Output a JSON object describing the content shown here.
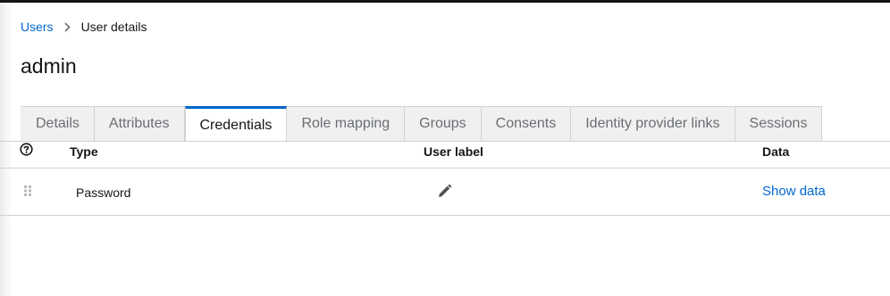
{
  "breadcrumb": {
    "parent": "Users",
    "current": "User details"
  },
  "page_title": "admin",
  "tabs": [
    {
      "label": "Details"
    },
    {
      "label": "Attributes"
    },
    {
      "label": "Credentials",
      "active": true
    },
    {
      "label": "Role mapping"
    },
    {
      "label": "Groups"
    },
    {
      "label": "Consents"
    },
    {
      "label": "Identity provider links"
    },
    {
      "label": "Sessions"
    }
  ],
  "table": {
    "headers": {
      "type": "Type",
      "user_label": "User label",
      "data": "Data"
    },
    "rows": [
      {
        "type": "Password",
        "data_action": "Show data"
      }
    ]
  },
  "colors": {
    "link": "#0066cc",
    "active_tab_border": "#0066cc",
    "tab_bg": "#f0f0f0",
    "border": "#d2d2d2"
  },
  "icons": {
    "breadcrumb_separator": "chevron-right-icon",
    "help": "question-circle-icon",
    "drag": "grip-vertical-icon",
    "edit": "pencil-icon"
  }
}
